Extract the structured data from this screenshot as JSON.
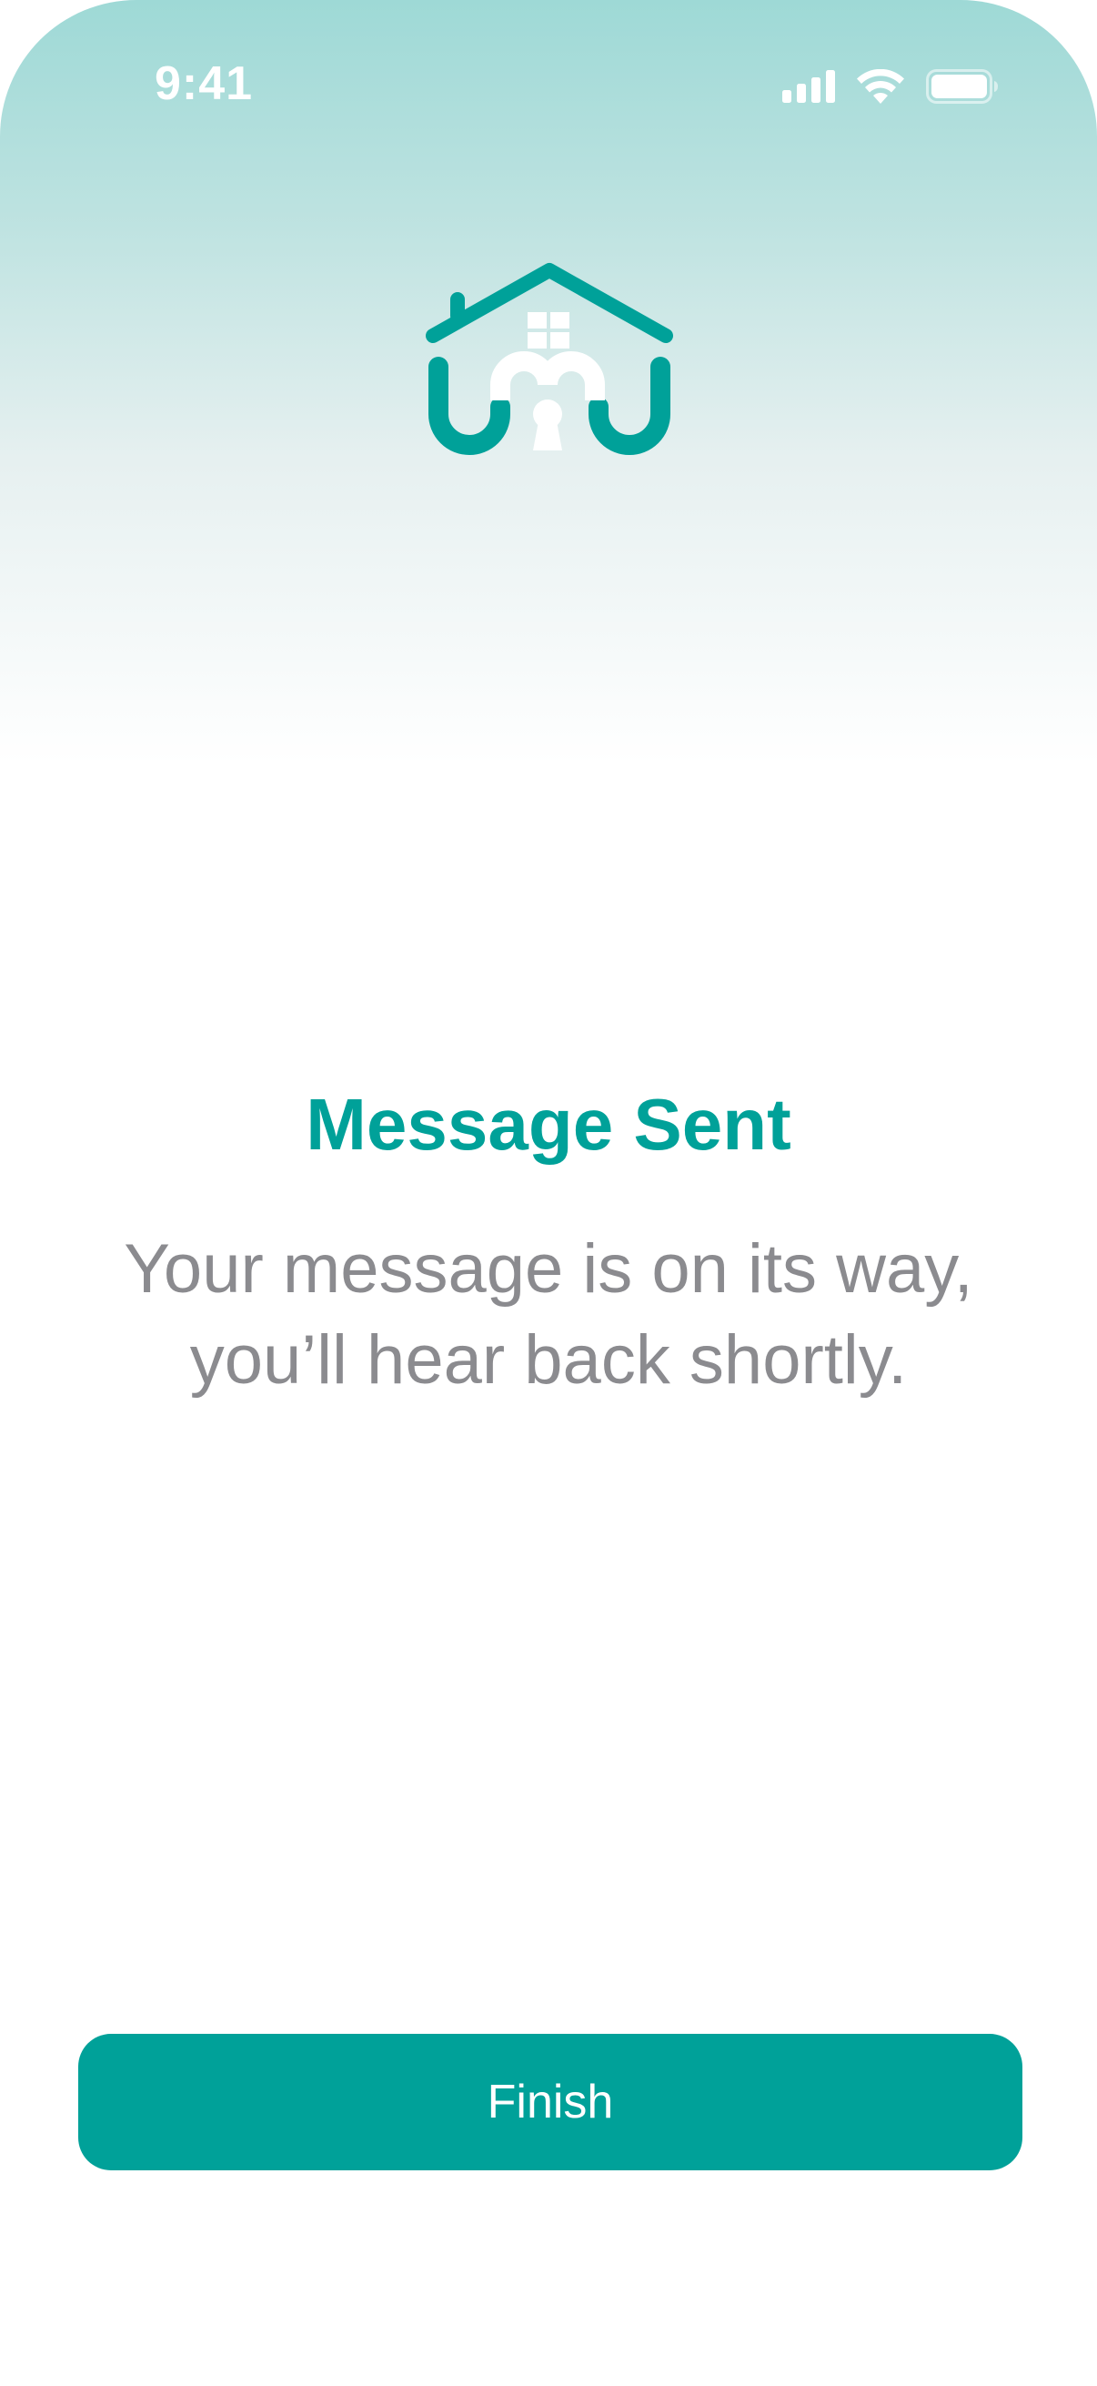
{
  "status_bar": {
    "time": "9:41",
    "icons": [
      "cellular-signal-icon",
      "wifi-icon",
      "battery-icon"
    ]
  },
  "logo": {
    "icon": "house-logo-icon"
  },
  "main": {
    "title": "Message Sent",
    "subtitle_line1": "Your message is on its way,",
    "subtitle_line2": "you’ll hear back shortly."
  },
  "actions": {
    "finish_label": "Finish"
  },
  "colors": {
    "accent": "#00a199",
    "subtitle_text": "#8b8b8f",
    "header_gradient_top": "#9ed9d6",
    "background": "#ffffff"
  }
}
